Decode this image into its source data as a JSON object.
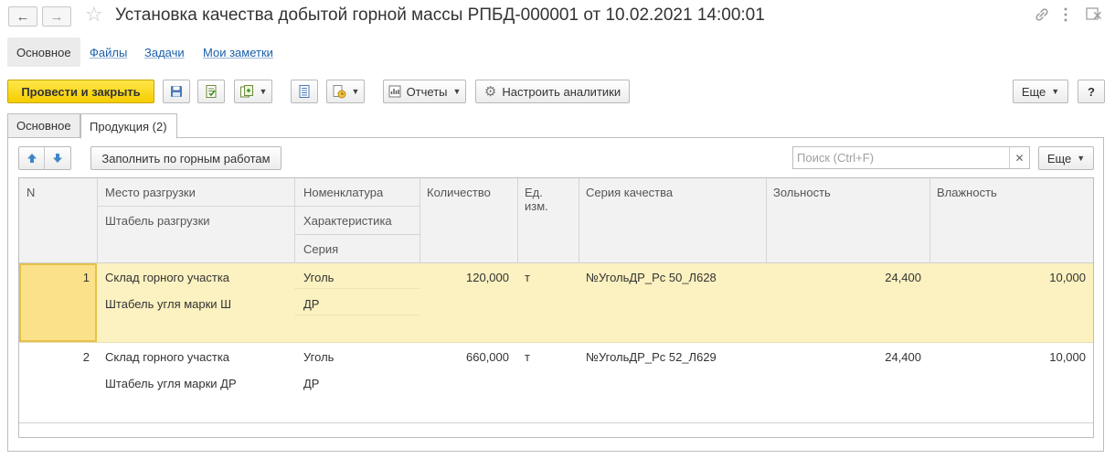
{
  "window": {
    "title": "Установка качества добытой горной массы РПБД-000001 от 10.02.2021 14:00:01"
  },
  "nav": {
    "back_icon": "arrow-left-icon",
    "forward_icon": "arrow-right-icon",
    "sections": [
      "Основное",
      "Файлы",
      "Задачи",
      "Мои заметки"
    ]
  },
  "toolbar": {
    "post_close_label": "Провести и закрыть",
    "reports_label": "Отчеты",
    "analytics_label": "Настроить аналитики",
    "more_label": "Еще",
    "help_label": "?"
  },
  "tabs": [
    "Основное",
    "Продукция (2)"
  ],
  "table_toolbar": {
    "fill_label": "Заполнить по горным работам",
    "search_placeholder": "Поиск (Ctrl+F)",
    "more_label": "Еще"
  },
  "table": {
    "headers": {
      "n": "N",
      "place": "Место разгрузки",
      "stack": "Штабель разгрузки",
      "nomenclature": "Номенклатура",
      "characteristic": "Характеристика",
      "series": "Серия",
      "quantity": "Количество",
      "unit": "Ед. изм.",
      "quality_series": "Серия качества",
      "ash": "Зольность",
      "moisture": "Влажность"
    },
    "rows": [
      {
        "n": "1",
        "place": "Склад горного участка",
        "stack": "Штабель угля марки Ш",
        "nomenclature": "Уголь",
        "characteristic": "ДР",
        "series": "",
        "quantity": "120,000",
        "unit": "т",
        "quality_series": "№УгольДР_Рс 50_Л628",
        "ash": "24,400",
        "moisture": "10,000"
      },
      {
        "n": "2",
        "place": "Склад горного участка",
        "stack": "Штабель угля марки ДР",
        "nomenclature": "Уголь",
        "characteristic": "ДР",
        "series": "",
        "quantity": "660,000",
        "unit": "т",
        "quality_series": "№УгольДР_Рс 52_Л629",
        "ash": "24,400",
        "moisture": "10,000"
      }
    ]
  },
  "colors": {
    "primary_button": "#f5cd00",
    "selected_row": "#fcf1c0",
    "selected_cell": "#fbe28a",
    "link": "#1a5fa8"
  }
}
